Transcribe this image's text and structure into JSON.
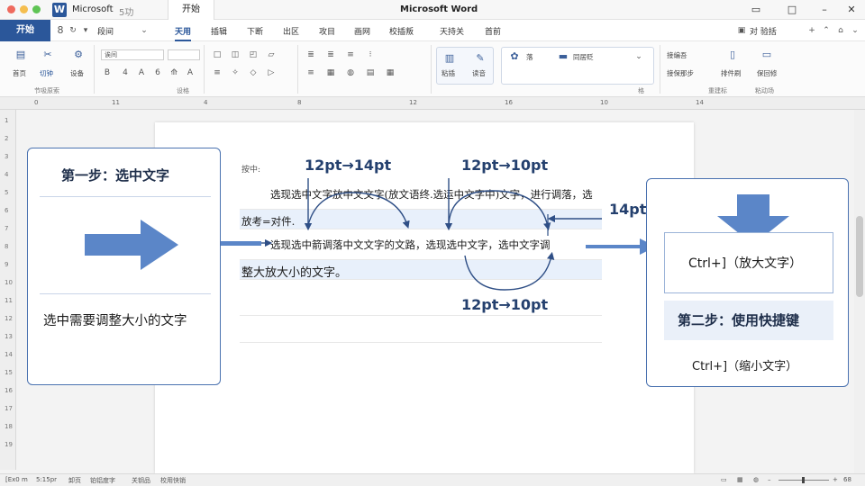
{
  "window": {
    "app_name": "Microsoft",
    "app_subtitle": "5功",
    "doc_tab": "开始",
    "title": "Microsoft Word"
  },
  "ribbon_tabs": {
    "file": "开始",
    "tabs": [
      "天用",
      "插辑",
      "下断",
      "出区",
      "攻目",
      "画网",
      "校插叛",
      "天持关",
      "首前"
    ],
    "active_index": 0,
    "right": [
      "对 验括"
    ],
    "quick_combo": "段间"
  },
  "ribbon": {
    "home_label": "首页",
    "paste_label": "切钟",
    "settings_label": "设备",
    "group1": "节吸原索",
    "font_combo": "诶间",
    "group2": "设格",
    "styles": [
      "落",
      "同居贬"
    ],
    "paste_btn": "粘插",
    "read_btn": "读音",
    "group3": "格",
    "right_btn1": "接编吾",
    "right_btn2": "接保那步",
    "right_btn3": "排件刷",
    "right_btn4": "保回修",
    "group4": "重建标",
    "group5": "粘动场"
  },
  "ruler": {
    "h_marks": [
      "0",
      "11",
      "4",
      "8",
      "12",
      "16",
      "10",
      "14"
    ],
    "v_marks": [
      "1",
      "2",
      "3",
      "4",
      "5",
      "6",
      "7",
      "8",
      "9",
      "10",
      "11",
      "12",
      "13",
      "14",
      "15",
      "16",
      "17",
      "18",
      "19"
    ]
  },
  "document": {
    "caption": "按中:",
    "line1": "选现选中文字放中文文字(放文语终.选运中文字中)文字，进行调落，选",
    "line2": "放考=对件.",
    "line3": "选现选中箭调落中文文字的文路，选现选中文字，选中文字调",
    "line4": "整大放大小的文字。",
    "pt_top_left": "12pt→14pt",
    "pt_top_right": "12pt→10pt",
    "pt_side": "14pt",
    "pt_bottom": "12pt→10pt"
  },
  "left_card": {
    "title": "第一步：选中文字",
    "text": "选中需要调整大小的文字"
  },
  "right_card": {
    "enlarge": "Ctrl+]（放大文字）",
    "title": "第二步：使用快捷键",
    "shrink": "Ctrl+]（缩小文字）"
  },
  "statusbar": {
    "items": [
      "[Ex0 m",
      "5:15pr",
      "卸页",
      "铂铝度字",
      "关钥品",
      "校用快销"
    ],
    "zoom": "68"
  },
  "colors": {
    "brand": "#2b579a",
    "accent": "#4a72b0",
    "arrow": "#5b86c8"
  }
}
